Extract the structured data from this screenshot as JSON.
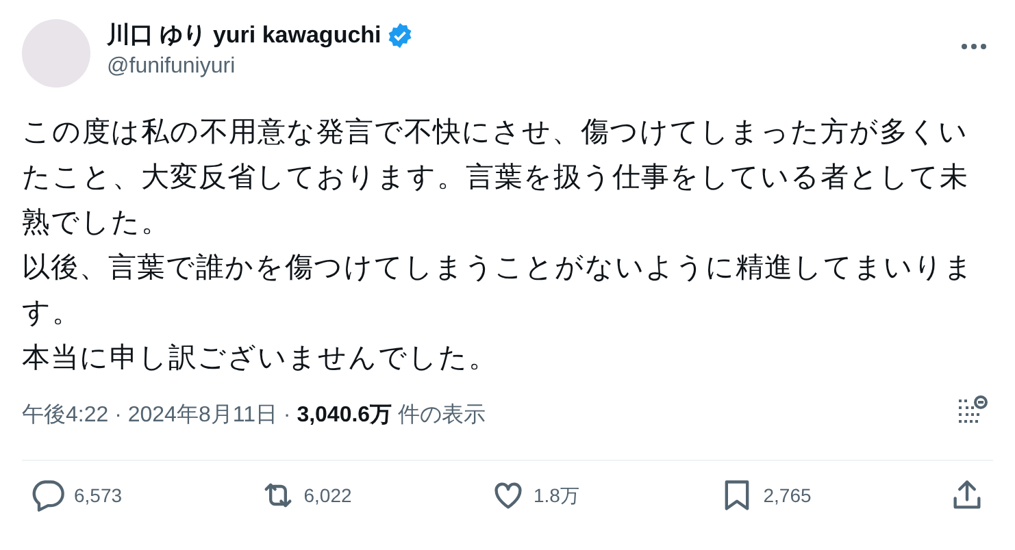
{
  "author": {
    "name": "川口 ゆり yuri kawaguchi",
    "verified": true,
    "handle": "@funifuniyuri"
  },
  "body": [
    "この度は私の不用意な発言で不快にさせ、傷つけてしまった方が多くいたこと、大変反省しております。言葉を扱う仕事をしている者として未熟でした。",
    "以後、言葉で誰かを傷つけてしまうことがないように精進してまいります。",
    "本当に申し訳ございませんでした。"
  ],
  "meta": {
    "time": "午後4:22",
    "separator_1": "·",
    "date": "2024年8月11日",
    "separator_2": "·",
    "views": "3,040.6万",
    "views_label": "件の表示"
  },
  "actions": [
    {
      "kind": "reply",
      "count": "6,573"
    },
    {
      "kind": "repost",
      "count": "6,022"
    },
    {
      "kind": "like",
      "count": "1.8万"
    },
    {
      "kind": "bookmark",
      "count": "2,765"
    },
    {
      "kind": "share"
    }
  ]
}
